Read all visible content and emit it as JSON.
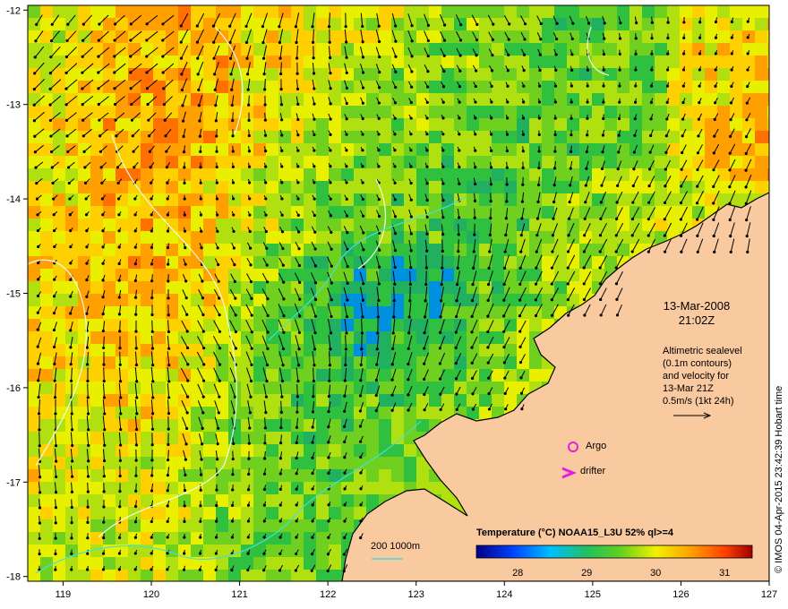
{
  "map": {
    "lon_ticks": [
      119,
      120,
      121,
      122,
      123,
      124,
      125,
      126,
      127
    ],
    "lat_ticks": [
      -12,
      -13,
      -14,
      -15,
      -16,
      -17,
      -18
    ],
    "lon_range": [
      118.6,
      127.0
    ],
    "lat_range": [
      -11.95,
      -18.05
    ],
    "date": "13-Mar-2008",
    "time": "21:02Z",
    "altimetry_lines": [
      "Altimetric sealevel",
      "(0.1m contours)",
      "and velocity for",
      "13-Mar 21Z",
      "0.5m/s (1kt 24h)"
    ],
    "legend_argo": "Argo",
    "legend_drifter": "drifter",
    "depth_label": "200  1000m",
    "colorbar": {
      "title": "Temperature (°C) NOAA15_L3U 52% ql>=4",
      "ticks": [
        28,
        29,
        30,
        31
      ],
      "range": [
        27.4,
        31.4
      ]
    },
    "credit": "© IMOS 04-Apr-2015 23:42:39 Hobart time",
    "colors": {
      "land": "#f9c9a0",
      "argo": "#e020e0",
      "contour": "#e8ffe8",
      "depth_200": "#40e0e0"
    }
  }
}
